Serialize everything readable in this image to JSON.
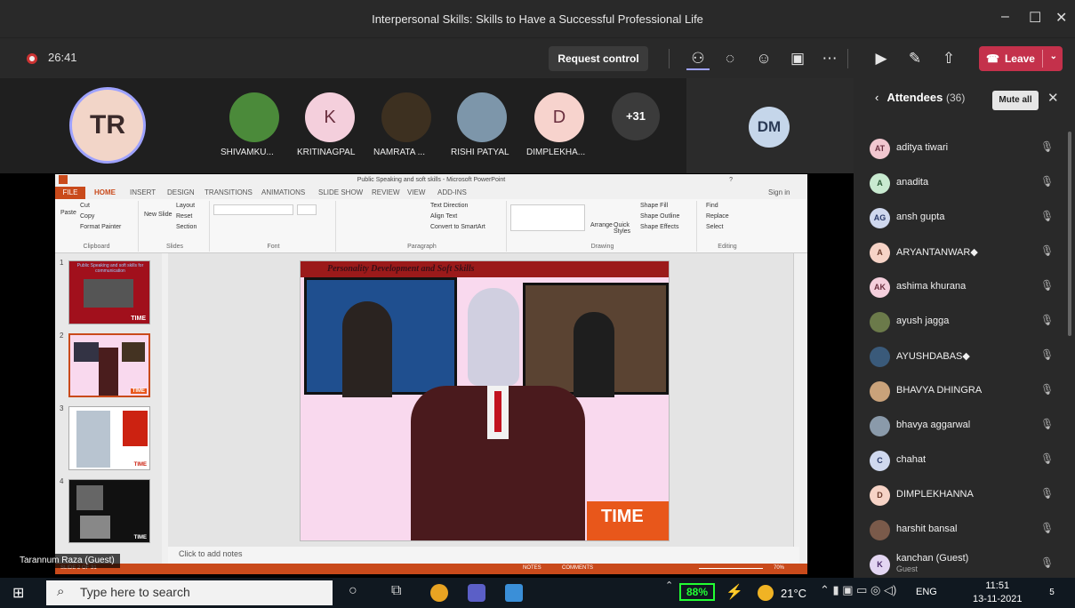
{
  "window": {
    "title": "Interpersonal Skills: Skills to Have a Successful Professional Life",
    "minimize": "–",
    "maximize": "☐",
    "close": "✕"
  },
  "meeting": {
    "timer": "26:41",
    "request_control": "Request control",
    "leave": "Leave"
  },
  "participants": {
    "presenter_initials": "TR",
    "tiles": [
      {
        "name": "SHIVAMKU...",
        "initials": ""
      },
      {
        "name": "KRITINAGPAL",
        "initials": "K"
      },
      {
        "name": "NAMRATA ...",
        "initials": ""
      },
      {
        "name": "RISHI PATYAL",
        "initials": ""
      },
      {
        "name": "DIMPLEKHA...",
        "initials": "D"
      }
    ],
    "overflow": "+31",
    "self_initials": "DM"
  },
  "ppt": {
    "title": "Public Speaking and soft skills - Microsoft PowerPoint",
    "sign_in": "Sign in",
    "help": "?",
    "tabs": [
      "FILE",
      "HOME",
      "INSERT",
      "DESIGN",
      "TRANSITIONS",
      "ANIMATIONS",
      "SLIDE SHOW",
      "REVIEW",
      "VIEW",
      "ADD-INS"
    ],
    "ribbon": {
      "cut": "Cut",
      "copy": "Copy",
      "format_painter": "Format Painter",
      "paste": "Paste",
      "clipboard": "Clipboard",
      "layout": "Layout",
      "reset": "Reset",
      "section": "Section",
      "new_slide": "New Slide",
      "slides": "Slides",
      "font": "Font",
      "paragraph": "Paragraph",
      "text_direction": "Text Direction",
      "align_text": "Align Text",
      "convert_smartart": "Convert to SmartArt",
      "arrange": "Arrange",
      "quick_styles": "Quick Styles",
      "shape_fill": "Shape Fill",
      "shape_outline": "Shape Outline",
      "shape_effects": "Shape Effects",
      "drawing": "Drawing",
      "find": "Find",
      "replace": "Replace",
      "select": "Select",
      "editing": "Editing"
    },
    "thumbs": [
      {
        "num": "1",
        "caption": "Public Speaking and soft skills for communication",
        "logo": "TIME"
      },
      {
        "num": "2",
        "caption": "",
        "logo": "TIME"
      },
      {
        "num": "3",
        "caption": "",
        "logo": "TIME"
      },
      {
        "num": "4",
        "caption": "",
        "logo": "TIME"
      }
    ],
    "slide": {
      "title": "Personality Development and Soft Skills",
      "logo": "TIME"
    },
    "notes_placeholder": "Click to add notes",
    "status": {
      "slide": "SLIDE 2 OF 31",
      "notes": "NOTES",
      "comments": "COMMENTS",
      "zoom": "70%"
    }
  },
  "guest_label": "Tarannum Raza (Guest)",
  "attendees": {
    "header": "Attendees",
    "count": "(36)",
    "mute_all": "Mute all",
    "list": [
      {
        "initials": "AT",
        "name": "aditya tiwari",
        "sub": ""
      },
      {
        "initials": "A",
        "name": "anadita",
        "sub": ""
      },
      {
        "initials": "AG",
        "name": "ansh gupta",
        "sub": ""
      },
      {
        "initials": "A",
        "name": "ARYANTANWAR◆",
        "sub": ""
      },
      {
        "initials": "AK",
        "name": "ashima khurana",
        "sub": ""
      },
      {
        "initials": "",
        "name": "ayush jagga",
        "sub": ""
      },
      {
        "initials": "",
        "name": "AYUSHDABAS◆",
        "sub": ""
      },
      {
        "initials": "",
        "name": "BHAVYA DHINGRA",
        "sub": ""
      },
      {
        "initials": "",
        "name": "bhavya aggarwal",
        "sub": ""
      },
      {
        "initials": "C",
        "name": "chahat",
        "sub": ""
      },
      {
        "initials": "D",
        "name": "DIMPLEKHANNA",
        "sub": ""
      },
      {
        "initials": "",
        "name": "harshit bansal",
        "sub": ""
      },
      {
        "initials": "K",
        "name": "kanchan (Guest)",
        "sub": "Guest"
      }
    ]
  },
  "taskbar": {
    "search_placeholder": "Type here to search",
    "battery": "88%",
    "temperature": "21°C",
    "language": "ENG",
    "time": "11:51",
    "date": "13-11-2021",
    "notifications": "5"
  }
}
